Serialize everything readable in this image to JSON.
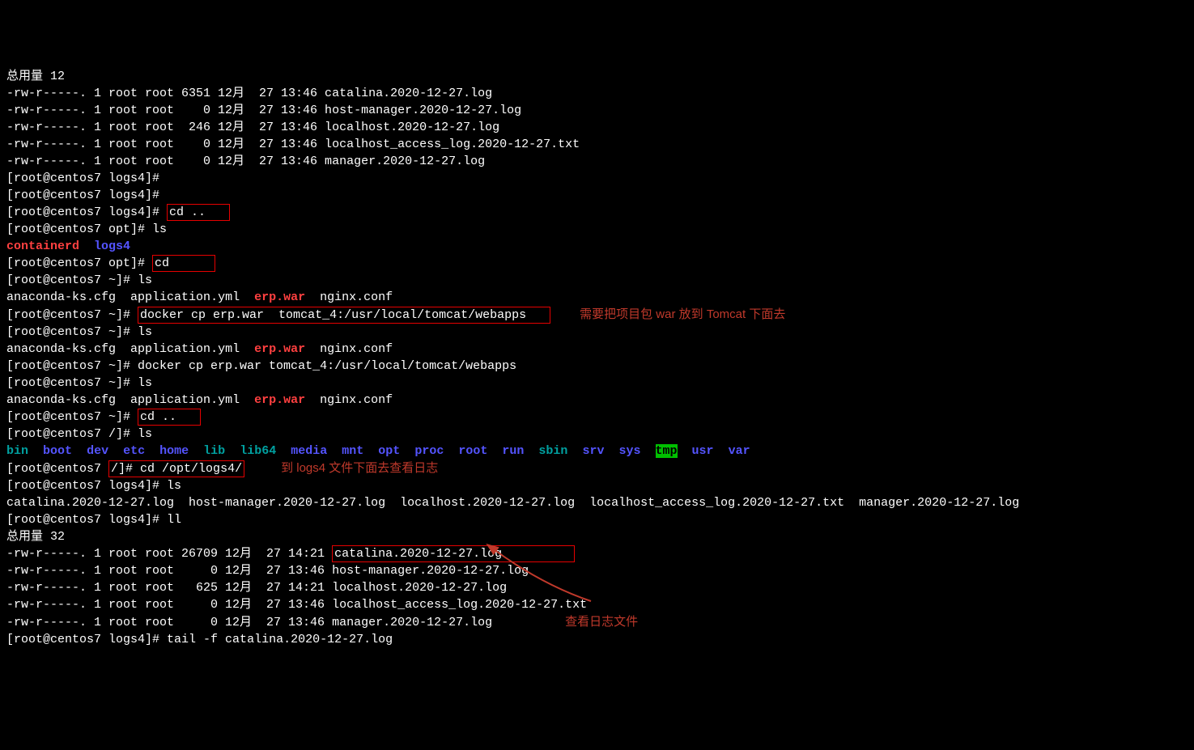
{
  "header": "总用量 12",
  "ls1": [
    "-rw-r-----. 1 root root 6351 12月  27 13:46 catalina.2020-12-27.log",
    "-rw-r-----. 1 root root    0 12月  27 13:46 host-manager.2020-12-27.log",
    "-rw-r-----. 1 root root  246 12月  27 13:46 localhost.2020-12-27.log",
    "-rw-r-----. 1 root root    0 12月  27 13:46 localhost_access_log.2020-12-27.txt",
    "-rw-r-----. 1 root root    0 12月  27 13:46 manager.2020-12-27.log"
  ],
  "p_logs4": "[root@centos7 logs4]# ",
  "p_opt": "[root@centos7 opt]# ",
  "p_home": "[root@centos7 ~]# ",
  "p_root": "[root@centos7 /]# ",
  "cmd_cd_up": "cd ..",
  "cmd_ls": "ls",
  "cmd_cd": "cd",
  "cmd_ll": "ll",
  "opt_dir_containerd": "containerd",
  "opt_dir_logs4": "logs4",
  "home_files": {
    "a": "anaconda-ks.cfg",
    "b": "application.yml",
    "erp": "erp.war",
    "ng": "nginx.conf"
  },
  "cmd_docker1": "docker cp erp.war  tomcat_4:/usr/local/tomcat/webapps",
  "cmd_docker2": "docker cp erp.war tomcat_4:/usr/local/tomcat/webapps",
  "annot1": "需要把项目包 war 放到 Tomcat 下面去",
  "root_dirs": {
    "bin": "bin",
    "boot": "boot",
    "dev": "dev",
    "etc": "etc",
    "home": "home",
    "lib": "lib",
    "lib64": "lib64",
    "media": "media",
    "mnt": "mnt",
    "opt": "opt",
    "proc": "proc",
    "root": "root",
    "run": "run",
    "sbin": "sbin",
    "srv": "srv",
    "sys": "sys",
    "tmp": "tmp",
    "usr": "usr",
    "var": "var"
  },
  "cmd_cd_logs4": "cd /opt/logs4/",
  "annot2": "到 logs4 文件下面去查看日志",
  "logs4_ls": "catalina.2020-12-27.log  host-manager.2020-12-27.log  localhost.2020-12-27.log  localhost_access_log.2020-12-27.txt  manager.2020-12-27.log",
  "header2": "总用量 32",
  "ls2_line0_pre": "-rw-r-----. 1 root root 26709 12月  27 14:21",
  "ls2_line0_file": "catalina.2020-12-27.log",
  "ls2_rest": [
    "-rw-r-----. 1 root root     0 12月  27 13:46 host-manager.2020-12-27.log",
    "-rw-r-----. 1 root root   625 12月  27 14:21 localhost.2020-12-27.log",
    "-rw-r-----. 1 root root     0 12月  27 13:46 localhost_access_log.2020-12-27.txt",
    "-rw-r-----. 1 root root     0 12月  27 13:46 manager.2020-12-27.log"
  ],
  "annot3": "查看日志文件",
  "cmd_tail": "tail -f catalina.2020-12-27.log",
  "root_prompt_bracket_open": "[root@centos7 ",
  "root_prompt_slash": "/]# "
}
